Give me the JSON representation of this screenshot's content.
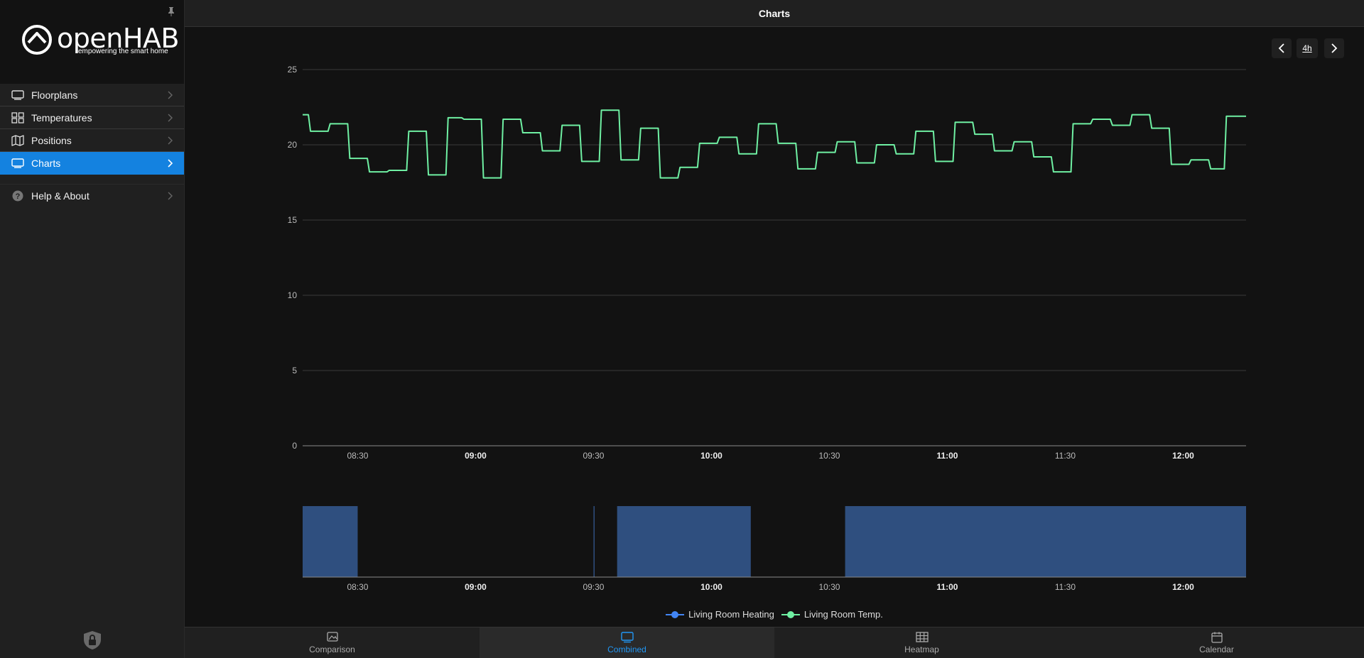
{
  "app": {
    "logo_text": "openHAB",
    "logo_subtitle": "empowering the smart home"
  },
  "header": {
    "title": "Charts"
  },
  "sidebar": {
    "items": [
      {
        "label": "Floorplans",
        "icon": "floorplan-icon",
        "active": false
      },
      {
        "label": "Temperatures",
        "icon": "grid-icon",
        "active": false
      },
      {
        "label": "Positions",
        "icon": "map-icon",
        "active": false
      },
      {
        "label": "Charts",
        "icon": "chart-screen-icon",
        "active": true
      }
    ],
    "help": {
      "label": "Help & About",
      "icon": "help-icon"
    }
  },
  "period": {
    "label": "4h"
  },
  "toolbar": {
    "tabs": [
      {
        "label": "Comparison",
        "icon": "picture-icon",
        "active": false
      },
      {
        "label": "Combined",
        "icon": "screen-icon",
        "active": true
      },
      {
        "label": "Heatmap",
        "icon": "table-icon",
        "active": false
      },
      {
        "label": "Calendar",
        "icon": "calendar-icon",
        "active": false
      }
    ]
  },
  "colors": {
    "accent": "#1482e0",
    "temp_series": "#6ff0a3",
    "heating_series": "#2f4f7f",
    "heating_legend": "#4285f4"
  },
  "chart_data": [
    {
      "type": "line",
      "title": "",
      "x_ticks": [
        "08:30",
        "09:00",
        "09:30",
        "10:00",
        "10:30",
        "11:00",
        "11:30",
        "12:00"
      ],
      "x_ticks_bold": [
        "09:00",
        "10:00",
        "11:00",
        "12:00"
      ],
      "y_ticks": [
        "0",
        "5",
        "10",
        "15",
        "20",
        "25"
      ],
      "ylim": [
        0,
        25
      ],
      "xlim": [
        "08:16",
        "12:16"
      ],
      "grid": true,
      "series": [
        {
          "name": "Living Room Temp.",
          "step": true,
          "points": [
            [
              "08:16",
              22.0
            ],
            [
              "08:18",
              20.9
            ],
            [
              "08:23",
              21.4
            ],
            [
              "08:28",
              19.1
            ],
            [
              "08:33",
              18.2
            ],
            [
              "08:38",
              18.3
            ],
            [
              "08:43",
              20.9
            ],
            [
              "08:48",
              18.0
            ],
            [
              "08:53",
              21.8
            ],
            [
              "08:57",
              21.7
            ],
            [
              "09:02",
              17.8
            ],
            [
              "09:07",
              21.7
            ],
            [
              "09:12",
              20.8
            ],
            [
              "09:17",
              19.6
            ],
            [
              "09:22",
              21.3
            ],
            [
              "09:27",
              18.9
            ],
            [
              "09:32",
              22.3
            ],
            [
              "09:37",
              19.0
            ],
            [
              "09:42",
              21.1
            ],
            [
              "09:47",
              17.8
            ],
            [
              "09:52",
              18.5
            ],
            [
              "09:57",
              20.1
            ],
            [
              "10:02",
              20.5
            ],
            [
              "10:07",
              19.4
            ],
            [
              "10:12",
              21.4
            ],
            [
              "10:17",
              20.1
            ],
            [
              "10:22",
              18.4
            ],
            [
              "10:27",
              19.5
            ],
            [
              "10:32",
              20.2
            ],
            [
              "10:37",
              18.8
            ],
            [
              "10:42",
              20.0
            ],
            [
              "10:47",
              19.4
            ],
            [
              "10:52",
              20.9
            ],
            [
              "10:57",
              18.9
            ],
            [
              "11:02",
              21.5
            ],
            [
              "11:07",
              20.7
            ],
            [
              "11:12",
              19.6
            ],
            [
              "11:17",
              20.2
            ],
            [
              "11:22",
              19.2
            ],
            [
              "11:27",
              18.2
            ],
            [
              "11:32",
              21.4
            ],
            [
              "11:37",
              21.7
            ],
            [
              "11:42",
              21.3
            ],
            [
              "11:47",
              22.0
            ],
            [
              "11:52",
              21.1
            ],
            [
              "11:57",
              18.7
            ],
            [
              "12:02",
              19.0
            ],
            [
              "12:07",
              18.4
            ],
            [
              "12:11",
              21.9
            ],
            [
              "12:16",
              21.9
            ]
          ]
        }
      ]
    },
    {
      "type": "area",
      "x_ticks": [
        "08:30",
        "09:00",
        "09:30",
        "10:00",
        "10:30",
        "11:00",
        "11:30",
        "12:00"
      ],
      "xlim": [
        "08:16",
        "12:16"
      ],
      "series": [
        {
          "name": "Living Room Heating",
          "segments": [
            [
              "08:16",
              "08:30"
            ],
            [
              "09:30",
              "09:30"
            ],
            [
              "09:36",
              "10:10"
            ],
            [
              "10:34",
              "12:16"
            ]
          ]
        }
      ]
    }
  ]
}
